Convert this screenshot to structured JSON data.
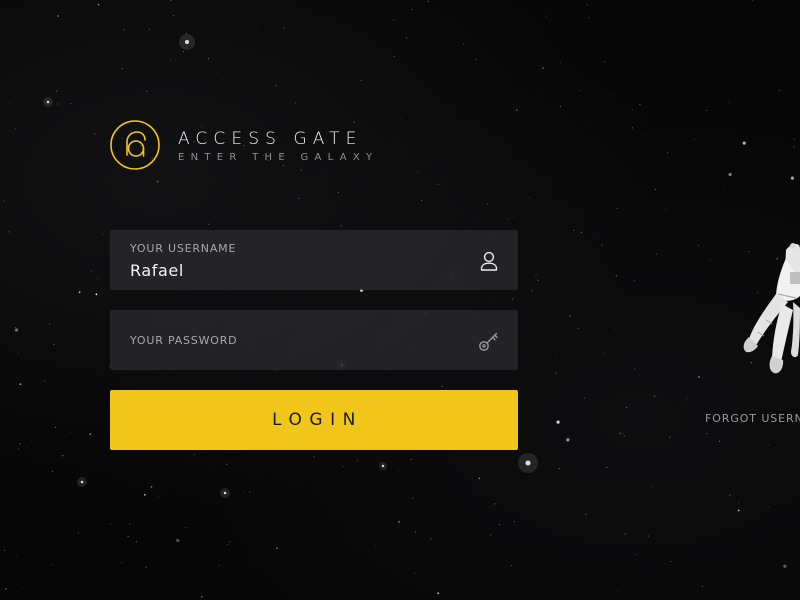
{
  "brand": {
    "logo_icon": "ra-monogram-icon",
    "title": "ACCESS GATE",
    "subtitle": "ENTER THE GALAXY",
    "accent_color": "#f1c61b"
  },
  "login_form": {
    "username": {
      "label": "YOUR USERNAME",
      "value": "Rafael",
      "icon": "user-icon"
    },
    "password": {
      "label": "YOUR PASSWORD",
      "value": "",
      "icon": "key-icon"
    },
    "submit_label": "LOGIN"
  },
  "forgot_link": {
    "label": "FORGOT USERN"
  },
  "colors": {
    "background": "#060606",
    "field_background": "#28282a",
    "button": "#f1c61b",
    "text": "#f4f4f4",
    "muted_text": "#a8a8a8"
  }
}
